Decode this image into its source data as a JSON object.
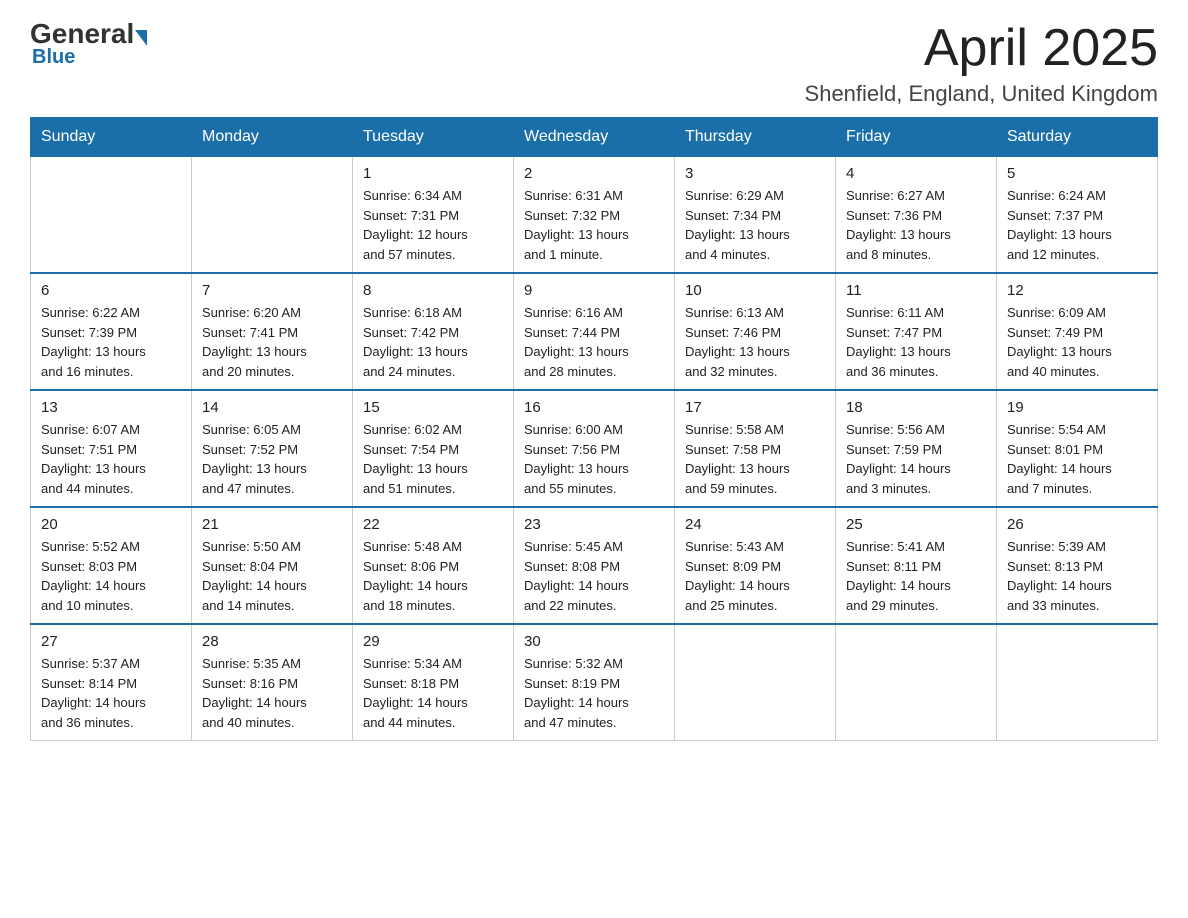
{
  "logo": {
    "general": "General",
    "blue": "Blue"
  },
  "header": {
    "month_title": "April 2025",
    "location": "Shenfield, England, United Kingdom"
  },
  "days_of_week": [
    "Sunday",
    "Monday",
    "Tuesday",
    "Wednesday",
    "Thursday",
    "Friday",
    "Saturday"
  ],
  "weeks": [
    [
      {
        "day": "",
        "info": ""
      },
      {
        "day": "",
        "info": ""
      },
      {
        "day": "1",
        "info": "Sunrise: 6:34 AM\nSunset: 7:31 PM\nDaylight: 12 hours\nand 57 minutes."
      },
      {
        "day": "2",
        "info": "Sunrise: 6:31 AM\nSunset: 7:32 PM\nDaylight: 13 hours\nand 1 minute."
      },
      {
        "day": "3",
        "info": "Sunrise: 6:29 AM\nSunset: 7:34 PM\nDaylight: 13 hours\nand 4 minutes."
      },
      {
        "day": "4",
        "info": "Sunrise: 6:27 AM\nSunset: 7:36 PM\nDaylight: 13 hours\nand 8 minutes."
      },
      {
        "day": "5",
        "info": "Sunrise: 6:24 AM\nSunset: 7:37 PM\nDaylight: 13 hours\nand 12 minutes."
      }
    ],
    [
      {
        "day": "6",
        "info": "Sunrise: 6:22 AM\nSunset: 7:39 PM\nDaylight: 13 hours\nand 16 minutes."
      },
      {
        "day": "7",
        "info": "Sunrise: 6:20 AM\nSunset: 7:41 PM\nDaylight: 13 hours\nand 20 minutes."
      },
      {
        "day": "8",
        "info": "Sunrise: 6:18 AM\nSunset: 7:42 PM\nDaylight: 13 hours\nand 24 minutes."
      },
      {
        "day": "9",
        "info": "Sunrise: 6:16 AM\nSunset: 7:44 PM\nDaylight: 13 hours\nand 28 minutes."
      },
      {
        "day": "10",
        "info": "Sunrise: 6:13 AM\nSunset: 7:46 PM\nDaylight: 13 hours\nand 32 minutes."
      },
      {
        "day": "11",
        "info": "Sunrise: 6:11 AM\nSunset: 7:47 PM\nDaylight: 13 hours\nand 36 minutes."
      },
      {
        "day": "12",
        "info": "Sunrise: 6:09 AM\nSunset: 7:49 PM\nDaylight: 13 hours\nand 40 minutes."
      }
    ],
    [
      {
        "day": "13",
        "info": "Sunrise: 6:07 AM\nSunset: 7:51 PM\nDaylight: 13 hours\nand 44 minutes."
      },
      {
        "day": "14",
        "info": "Sunrise: 6:05 AM\nSunset: 7:52 PM\nDaylight: 13 hours\nand 47 minutes."
      },
      {
        "day": "15",
        "info": "Sunrise: 6:02 AM\nSunset: 7:54 PM\nDaylight: 13 hours\nand 51 minutes."
      },
      {
        "day": "16",
        "info": "Sunrise: 6:00 AM\nSunset: 7:56 PM\nDaylight: 13 hours\nand 55 minutes."
      },
      {
        "day": "17",
        "info": "Sunrise: 5:58 AM\nSunset: 7:58 PM\nDaylight: 13 hours\nand 59 minutes."
      },
      {
        "day": "18",
        "info": "Sunrise: 5:56 AM\nSunset: 7:59 PM\nDaylight: 14 hours\nand 3 minutes."
      },
      {
        "day": "19",
        "info": "Sunrise: 5:54 AM\nSunset: 8:01 PM\nDaylight: 14 hours\nand 7 minutes."
      }
    ],
    [
      {
        "day": "20",
        "info": "Sunrise: 5:52 AM\nSunset: 8:03 PM\nDaylight: 14 hours\nand 10 minutes."
      },
      {
        "day": "21",
        "info": "Sunrise: 5:50 AM\nSunset: 8:04 PM\nDaylight: 14 hours\nand 14 minutes."
      },
      {
        "day": "22",
        "info": "Sunrise: 5:48 AM\nSunset: 8:06 PM\nDaylight: 14 hours\nand 18 minutes."
      },
      {
        "day": "23",
        "info": "Sunrise: 5:45 AM\nSunset: 8:08 PM\nDaylight: 14 hours\nand 22 minutes."
      },
      {
        "day": "24",
        "info": "Sunrise: 5:43 AM\nSunset: 8:09 PM\nDaylight: 14 hours\nand 25 minutes."
      },
      {
        "day": "25",
        "info": "Sunrise: 5:41 AM\nSunset: 8:11 PM\nDaylight: 14 hours\nand 29 minutes."
      },
      {
        "day": "26",
        "info": "Sunrise: 5:39 AM\nSunset: 8:13 PM\nDaylight: 14 hours\nand 33 minutes."
      }
    ],
    [
      {
        "day": "27",
        "info": "Sunrise: 5:37 AM\nSunset: 8:14 PM\nDaylight: 14 hours\nand 36 minutes."
      },
      {
        "day": "28",
        "info": "Sunrise: 5:35 AM\nSunset: 8:16 PM\nDaylight: 14 hours\nand 40 minutes."
      },
      {
        "day": "29",
        "info": "Sunrise: 5:34 AM\nSunset: 8:18 PM\nDaylight: 14 hours\nand 44 minutes."
      },
      {
        "day": "30",
        "info": "Sunrise: 5:32 AM\nSunset: 8:19 PM\nDaylight: 14 hours\nand 47 minutes."
      },
      {
        "day": "",
        "info": ""
      },
      {
        "day": "",
        "info": ""
      },
      {
        "day": "",
        "info": ""
      }
    ]
  ]
}
